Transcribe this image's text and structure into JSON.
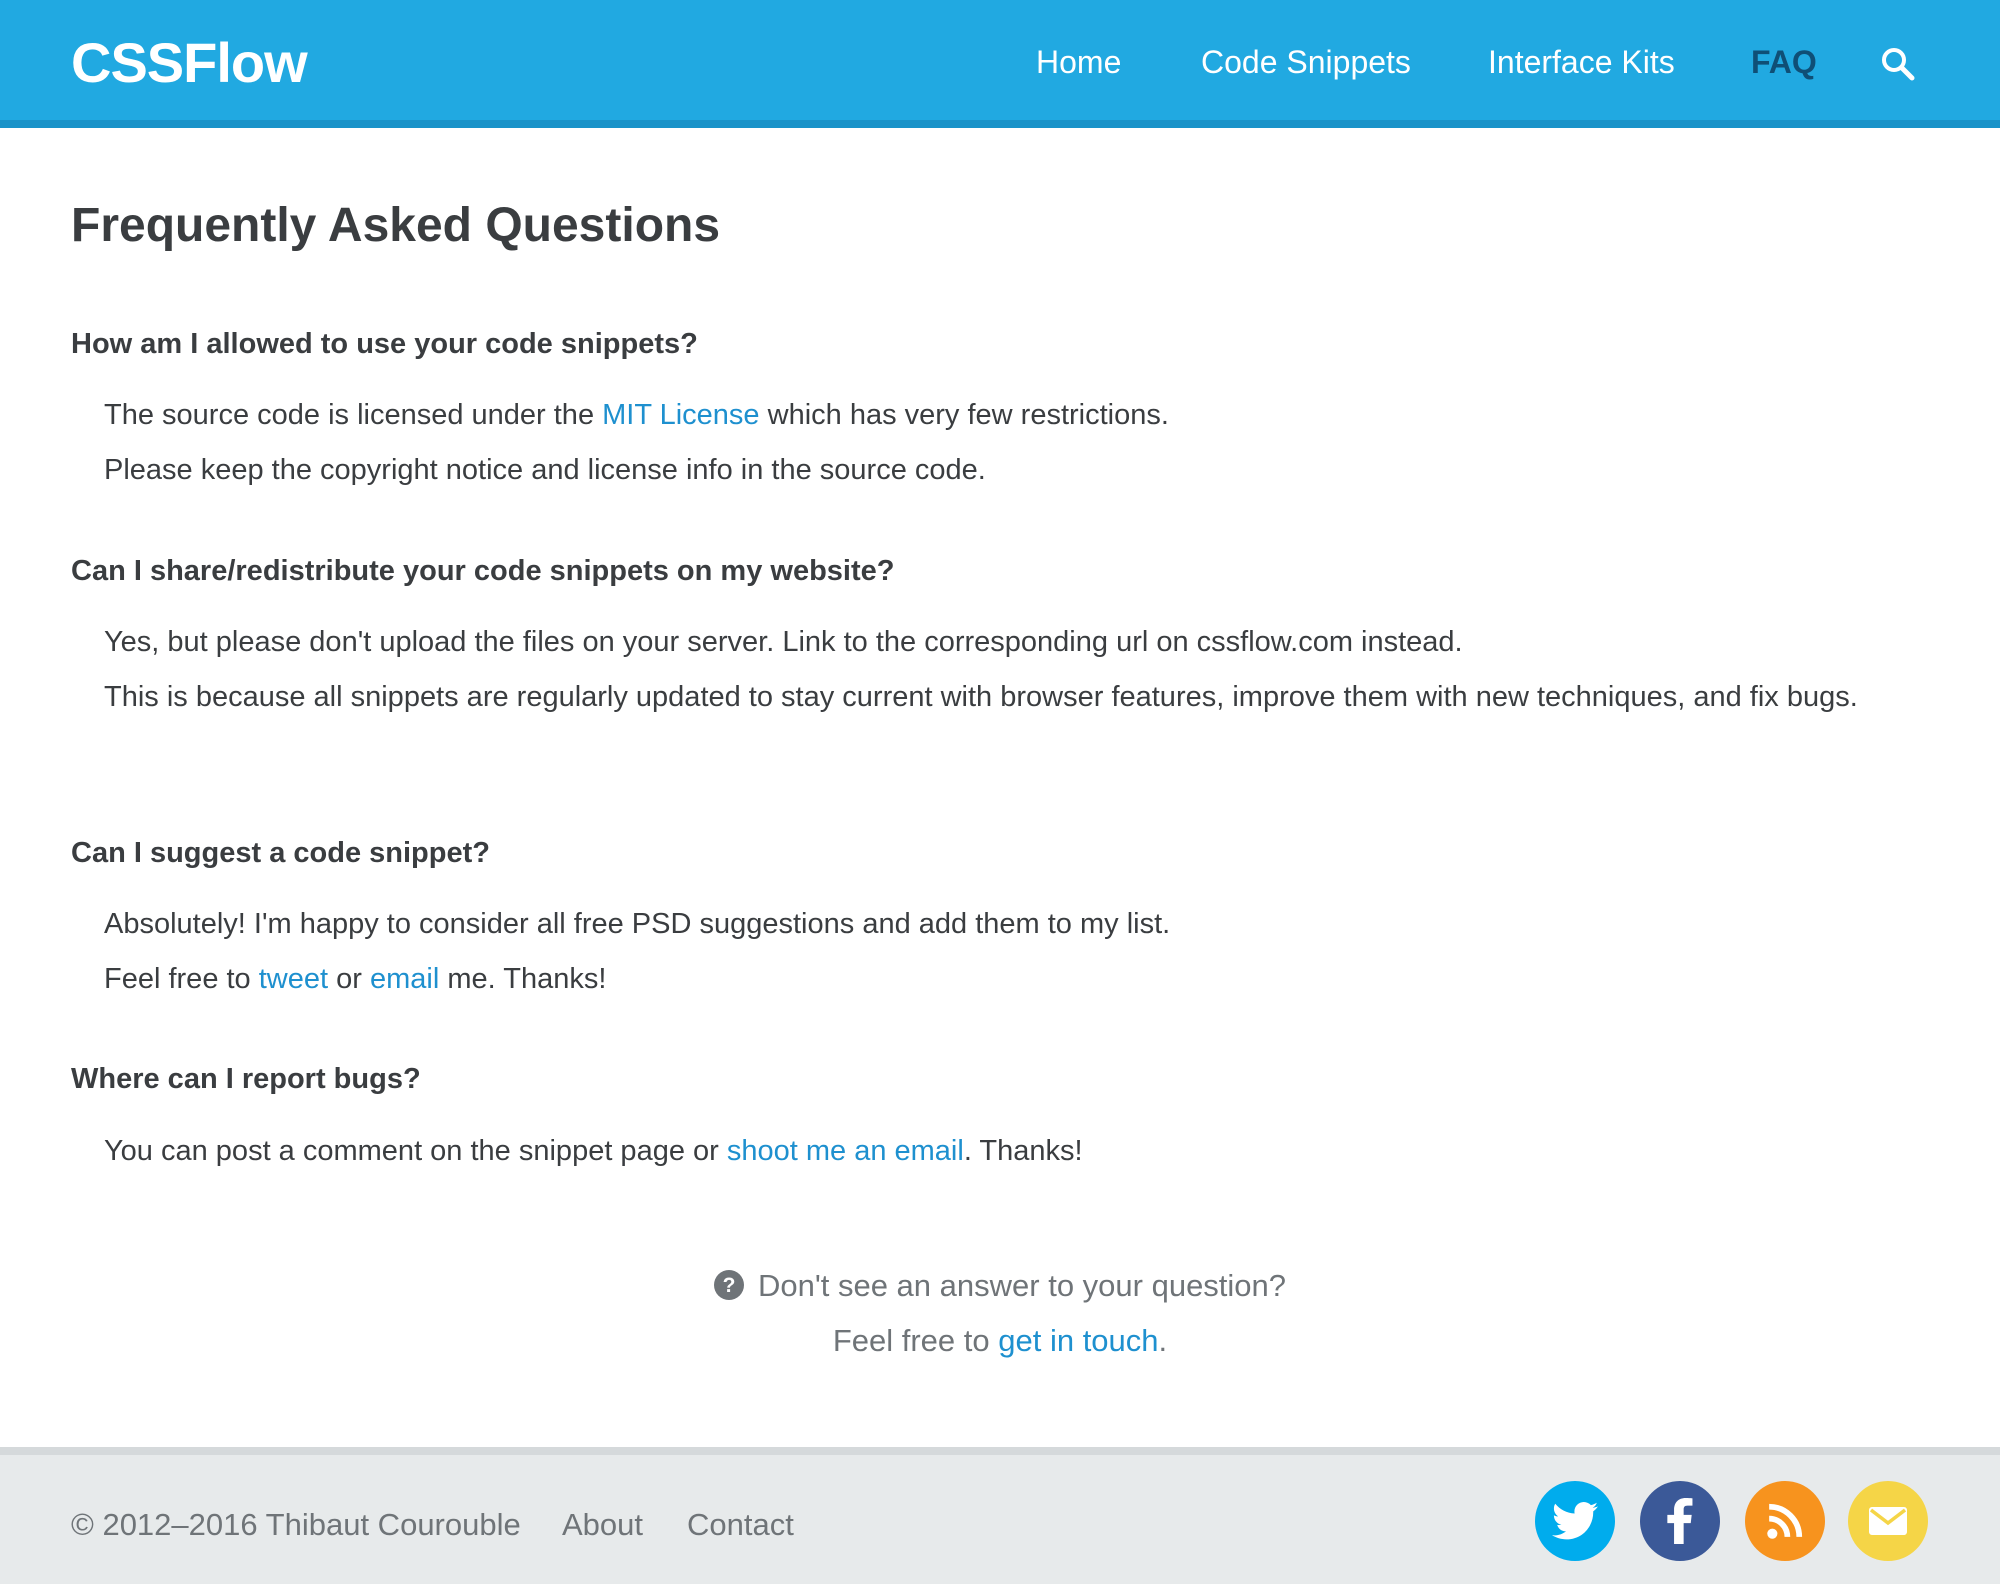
{
  "header": {
    "logo": "CSSFlow",
    "nav": [
      "Home",
      "Code Snippets",
      "Interface Kits",
      "FAQ"
    ],
    "search_icon": "search-icon",
    "colors": {
      "bar": "#21a9e1",
      "active": "#0f4f76"
    }
  },
  "main": {
    "title": "Frequently Asked Questions",
    "faqs": [
      {
        "question": "How am I allowed to use your code snippets?",
        "a1_pre": "The source code is licensed under the ",
        "a1_link": "MIT License",
        "a1_post": " which has very few restrictions.",
        "a2": "Please keep the copyright notice and license info in the source code."
      },
      {
        "question": "Can I share/redistribute your code snippets on my website?",
        "a1": "Yes, but please don't upload the files on your server. Link to the corresponding url on cssflow.com instead.",
        "a2": "This is because all snippets are regularly updated to stay current with browser features, improve them with new techniques, and fix bugs."
      },
      {
        "question": "Can I suggest a code snippet?",
        "a1": "Absolutely! I'm happy to consider all free PSD suggestions and add them to my list.",
        "a2_pre": "Feel free to ",
        "a2_link1": "tweet",
        "a2_mid": " or ",
        "a2_link2": "email",
        "a2_post": " me. Thanks!"
      },
      {
        "question": "Where can I report bugs?",
        "a1_pre": "You can post a comment on the snippet page or ",
        "a1_link": "shoot me an email",
        "a1_post": ". Thanks!"
      }
    ],
    "help": {
      "icon": "question-circle-icon",
      "line1": "Don't see an answer to your question?",
      "line2_pre": "Feel free to ",
      "line2_link": "get in touch",
      "line2_post": "."
    },
    "link_color": "#1e90cf"
  },
  "footer": {
    "copyright": "© 2012–2016 Thibaut Courouble",
    "links": [
      "About",
      "Contact"
    ],
    "social": [
      {
        "icon": "twitter-icon",
        "color": "#00aced"
      },
      {
        "icon": "facebook-icon",
        "color": "#3b5998"
      },
      {
        "icon": "rss-icon",
        "color": "#f7931e"
      },
      {
        "icon": "mail-icon",
        "color": "#f5d547"
      }
    ]
  }
}
